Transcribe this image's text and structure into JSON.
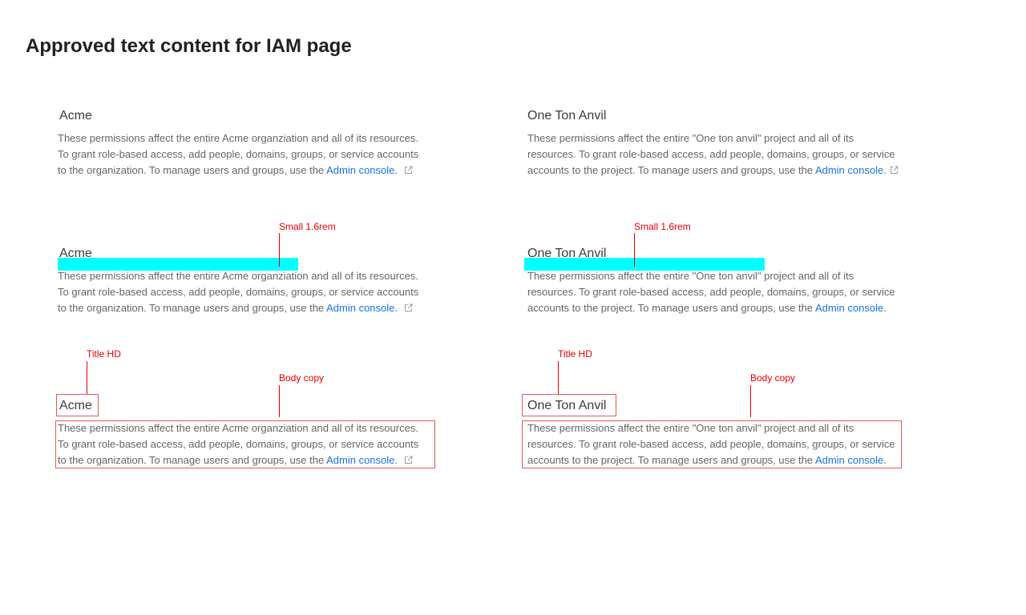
{
  "page": {
    "title": "Approved text content for IAM page"
  },
  "left": {
    "title": "Acme",
    "body_lines": [
      "These permissions affect the entire Acme organziation and all of its resources.",
      "To grant role-based access, add people, domains, groups, or service accounts",
      "to the organization. To manage users and groups, use the "
    ],
    "link_text": "Admin console.",
    "link_icon": "external-link-icon"
  },
  "right": {
    "title": "One Ton Anvil",
    "body_lines": [
      "These permissions affect the entire \"One ton anvil\" project and all of its",
      "resources. To grant role-based access, add people, domains, groups, or service",
      "accounts to the project. To manage users and groups, use the "
    ],
    "link_text": "Admin console.",
    "link_icon": "external-link-icon"
  },
  "annotations": {
    "small_label": "Small 1.6rem",
    "title_label": "Title HD",
    "body_label": "Body copy",
    "highlight_color": "#00ffff",
    "annotation_color": "#e00000"
  }
}
